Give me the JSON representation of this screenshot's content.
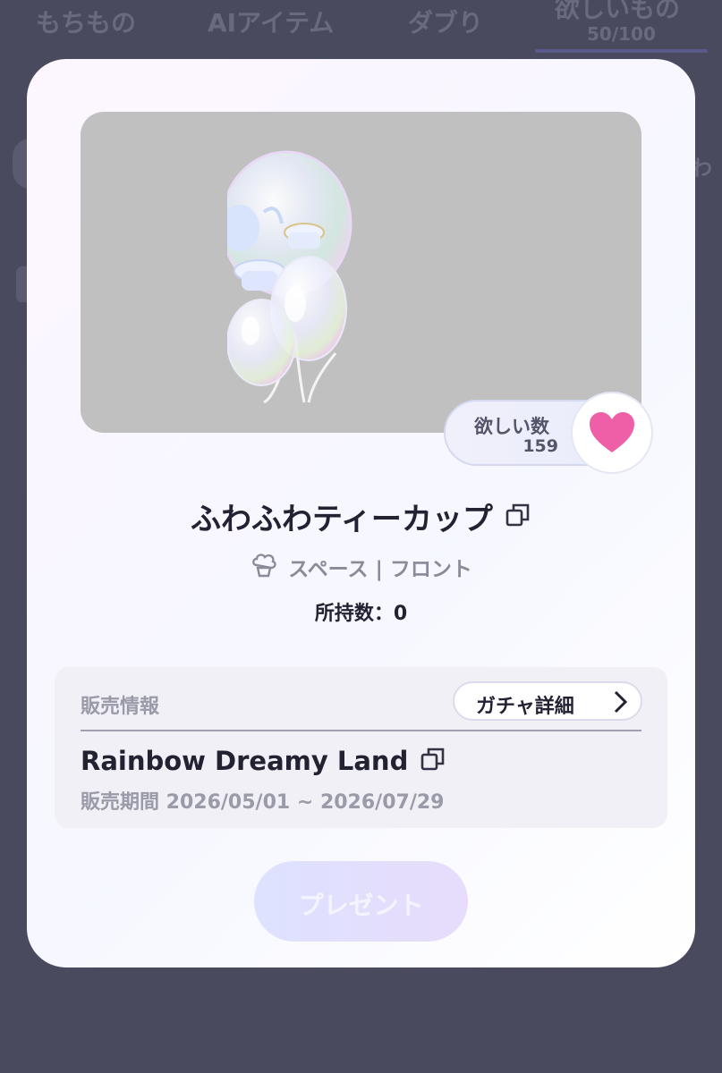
{
  "background": {
    "tabs": [
      {
        "label": "もちもの"
      },
      {
        "label": "AIアイテム"
      },
      {
        "label": "ダブり"
      },
      {
        "label": "欲しいもの",
        "count": "50/100"
      }
    ]
  },
  "modal": {
    "wish": {
      "label": "欲しい数",
      "count": "159"
    },
    "item": {
      "title": "ふわふわティーカップ",
      "category": "スペース | フロント",
      "owned": "所持数：0"
    },
    "sale": {
      "section_label": "販売情報",
      "gacha_button_label": "ガチャ詳細",
      "gacha_name": "Rainbow Dreamy Land",
      "period": "販売期間 2026/05/01 ~ 2026/07/29"
    },
    "present_button_label": "プレゼント"
  },
  "colors": {
    "heart": "#ee5fa8",
    "backdrop": "#4a4a5e",
    "present_disabled": "#dde2ff"
  },
  "icons": [
    "copy-icon",
    "heart-icon",
    "chevron-right-icon",
    "category-icon"
  ]
}
